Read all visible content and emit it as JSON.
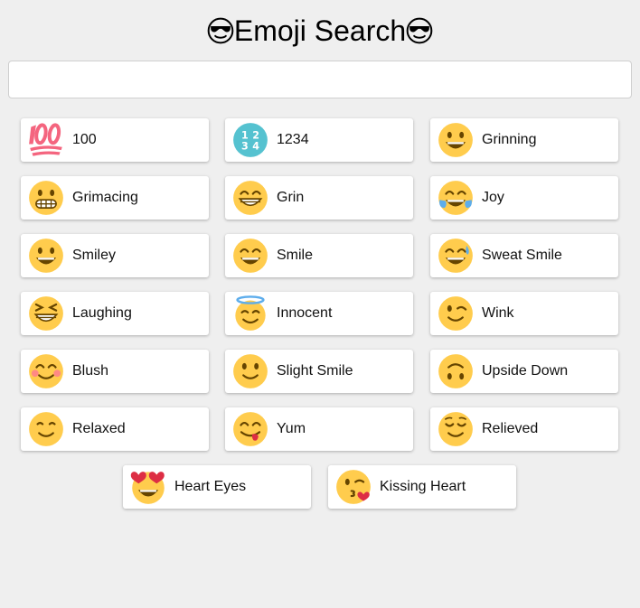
{
  "header": {
    "title": "Emoji Search",
    "title_icon": "smiling-face-with-sunglasses"
  },
  "search": {
    "value": "",
    "placeholder": ""
  },
  "emojis": [
    {
      "label": "100",
      "icon": "hundred-points"
    },
    {
      "label": "1234",
      "icon": "input-numbers"
    },
    {
      "label": "Grinning",
      "icon": "grinning-face"
    },
    {
      "label": "Grimacing",
      "icon": "grimacing-face"
    },
    {
      "label": "Grin",
      "icon": "beaming-face"
    },
    {
      "label": "Joy",
      "icon": "tears-of-joy-face"
    },
    {
      "label": "Smiley",
      "icon": "smiley-face"
    },
    {
      "label": "Smile",
      "icon": "smile-face"
    },
    {
      "label": "Sweat Smile",
      "icon": "sweat-smile-face"
    },
    {
      "label": "Laughing",
      "icon": "laughing-face"
    },
    {
      "label": "Innocent",
      "icon": "halo-face"
    },
    {
      "label": "Wink",
      "icon": "winking-face"
    },
    {
      "label": "Blush",
      "icon": "blushing-face"
    },
    {
      "label": "Slight Smile",
      "icon": "slightly-smiling-face"
    },
    {
      "label": "Upside Down",
      "icon": "upside-down-face"
    },
    {
      "label": "Relaxed",
      "icon": "relaxed-face"
    },
    {
      "label": "Yum",
      "icon": "yum-face"
    },
    {
      "label": "Relieved",
      "icon": "relieved-face"
    },
    {
      "label": "Heart Eyes",
      "icon": "heart-eyes-face"
    },
    {
      "label": "Kissing Heart",
      "icon": "kissing-heart-face"
    }
  ],
  "colors": {
    "background": "#efefef",
    "face": "#ffcc4d",
    "face_dark": "#664500",
    "hundred_red": "#f4657f",
    "numbers_teal": "#55c2d0",
    "tear_blue": "#5dadec",
    "blush_pink": "#ff7892",
    "heart_red": "#dd2e44",
    "halo_blue": "#5dadec"
  }
}
